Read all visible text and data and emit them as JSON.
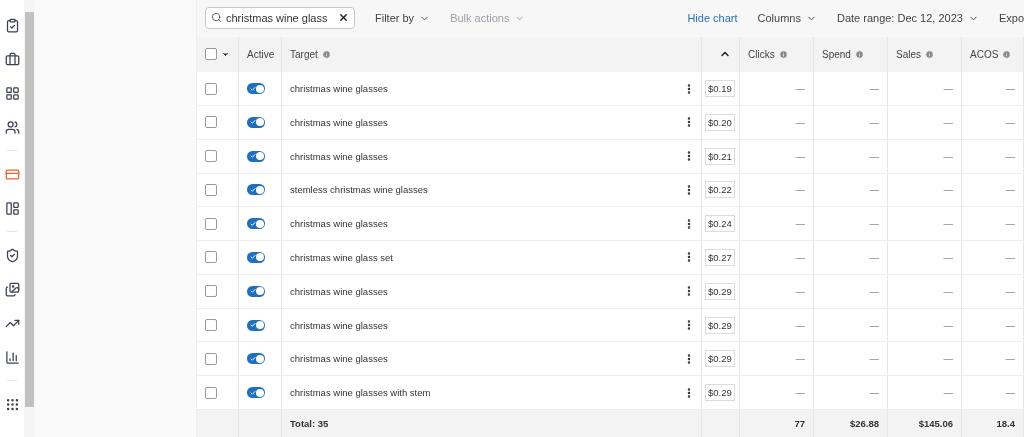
{
  "nav": {
    "groups": [
      [
        {
          "selected": false
        },
        {
          "selected": false
        },
        {
          "selected": false
        },
        {
          "selected": false
        }
      ],
      [
        {
          "selected": true
        },
        {
          "selected": false
        }
      ],
      [
        {
          "selected": false
        },
        {
          "selected": false
        },
        {
          "selected": false
        },
        {
          "selected": false
        }
      ],
      [
        {
          "selected": false
        }
      ]
    ]
  },
  "toolbar": {
    "search": {
      "value": "christmas wine glass"
    },
    "filter": {
      "label": "Filter by",
      "disabled": false
    },
    "bulk": {
      "label": "Bulk actions",
      "disabled": true
    },
    "hide_chart": "Hide chart",
    "columns": "Columns",
    "date_range": "Date range: Dec 12, 2023",
    "export": "Expo"
  },
  "table": {
    "select_all": {
      "checked": false
    },
    "columns": [
      "Active",
      "Target",
      "Clicks",
      "Spend",
      "Sales",
      "ACOS"
    ],
    "rows": [
      {
        "checked": false,
        "active": true,
        "target": "christmas wine glasses",
        "bid": "$0.19",
        "clicks": "—",
        "spend": "—",
        "sales": "—",
        "acos": "—"
      },
      {
        "checked": false,
        "active": true,
        "target": "christmas wine glasses",
        "bid": "$0.20",
        "clicks": "—",
        "spend": "—",
        "sales": "—",
        "acos": "—"
      },
      {
        "checked": false,
        "active": true,
        "target": "christmas wine glasses",
        "bid": "$0.21",
        "clicks": "—",
        "spend": "—",
        "sales": "—",
        "acos": "—"
      },
      {
        "checked": false,
        "active": true,
        "target": "stemless christmas wine glasses",
        "bid": "$0.22",
        "clicks": "—",
        "spend": "—",
        "sales": "—",
        "acos": "—"
      },
      {
        "checked": false,
        "active": true,
        "target": "christmas wine glasses",
        "bid": "$0.24",
        "clicks": "—",
        "spend": "—",
        "sales": "—",
        "acos": "—"
      },
      {
        "checked": false,
        "active": true,
        "target": "christmas wine glass set",
        "bid": "$0.27",
        "clicks": "—",
        "spend": "—",
        "sales": "—",
        "acos": "—"
      },
      {
        "checked": false,
        "active": true,
        "target": "christmas wine glasses",
        "bid": "$0.29",
        "clicks": "—",
        "spend": "—",
        "sales": "—",
        "acos": "—"
      },
      {
        "checked": false,
        "active": true,
        "target": "christmas wine glasses",
        "bid": "$0.29",
        "clicks": "—",
        "spend": "—",
        "sales": "—",
        "acos": "—"
      },
      {
        "checked": false,
        "active": true,
        "target": "christmas wine glasses",
        "bid": "$0.29",
        "clicks": "—",
        "spend": "—",
        "sales": "—",
        "acos": "—"
      },
      {
        "checked": false,
        "active": true,
        "target": "christmas wine glasses with stem",
        "bid": "$0.29",
        "clicks": "—",
        "spend": "—",
        "sales": "—",
        "acos": "—"
      }
    ],
    "total": {
      "label": "Total: 35",
      "clicks": "77",
      "spend": "$26.88",
      "sales": "$145.06",
      "acos": "18.4"
    }
  }
}
